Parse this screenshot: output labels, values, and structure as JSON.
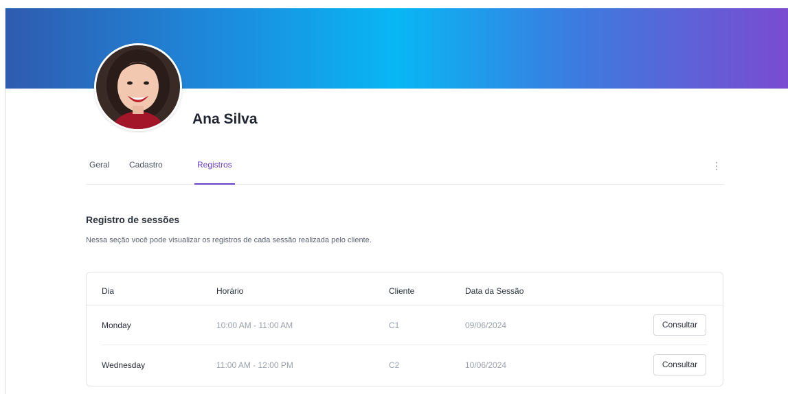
{
  "profile": {
    "name": "Ana Silva"
  },
  "tabs": [
    {
      "label": "Geral",
      "active": false
    },
    {
      "label": "Cadastro",
      "active": false
    },
    {
      "label": "Registros",
      "active": true
    }
  ],
  "section": {
    "title": "Registro de sessões",
    "description": "Nessa seção você pode visualizar os registros de cada sessão realizada pelo cliente."
  },
  "table": {
    "headers": [
      "Dia",
      "Horário",
      "Cliente",
      "Data da Sessão"
    ],
    "rows": [
      {
        "day": "Monday",
        "time": "10:00 AM - 11:00 AM",
        "client": "C1",
        "date": "09/06/2024",
        "action": "Consultar"
      },
      {
        "day": "Wednesday",
        "time": "11:00 AM - 12:00 PM",
        "client": "C2",
        "date": "10/06/2024",
        "action": "Consultar"
      }
    ]
  },
  "icons": {
    "more": "kebab-menu-icon"
  },
  "colors": {
    "accent": "#6a3fc8",
    "banner_start": "#2f5bb0",
    "banner_mid": "#08b7f5",
    "banner_end": "#7a4bd0"
  }
}
